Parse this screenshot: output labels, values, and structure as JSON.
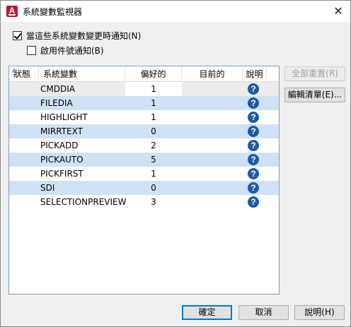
{
  "window": {
    "title": "系統變數監視器",
    "close_glyph": "✕"
  },
  "options": {
    "notify_label": "當這些系統變數變更時通知(N)",
    "notify_checked": true,
    "balloon_label": "啟用件號通知(B)",
    "balloon_checked": false
  },
  "table": {
    "headers": [
      "狀態",
      "系統變數",
      "偏好的",
      "目前的",
      "說明"
    ],
    "rows": [
      {
        "name": "CMDDIA",
        "preferred": "1",
        "current": ""
      },
      {
        "name": "FILEDIA",
        "preferred": "1",
        "current": ""
      },
      {
        "name": "HIGHLIGHT",
        "preferred": "1",
        "current": ""
      },
      {
        "name": "MIRRTEXT",
        "preferred": "0",
        "current": ""
      },
      {
        "name": "PICKADD",
        "preferred": "2",
        "current": ""
      },
      {
        "name": "PICKAUTO",
        "preferred": "5",
        "current": ""
      },
      {
        "name": "PICKFIRST",
        "preferred": "1",
        "current": ""
      },
      {
        "name": "SDI",
        "preferred": "0",
        "current": ""
      },
      {
        "name": "SELECTIONPREVIEW",
        "preferred": "3",
        "current": ""
      }
    ],
    "help_glyph": "?"
  },
  "side_buttons": {
    "reset_all": "全部重置(R)",
    "edit_list": "編輯清單(E)..."
  },
  "footer": {
    "ok": "確定",
    "cancel": "取消",
    "help": "說明(H)"
  },
  "colors": {
    "alt_row": "#cfe1f5",
    "help_icon": "#1d5aa8",
    "accent": "#0078d7"
  }
}
